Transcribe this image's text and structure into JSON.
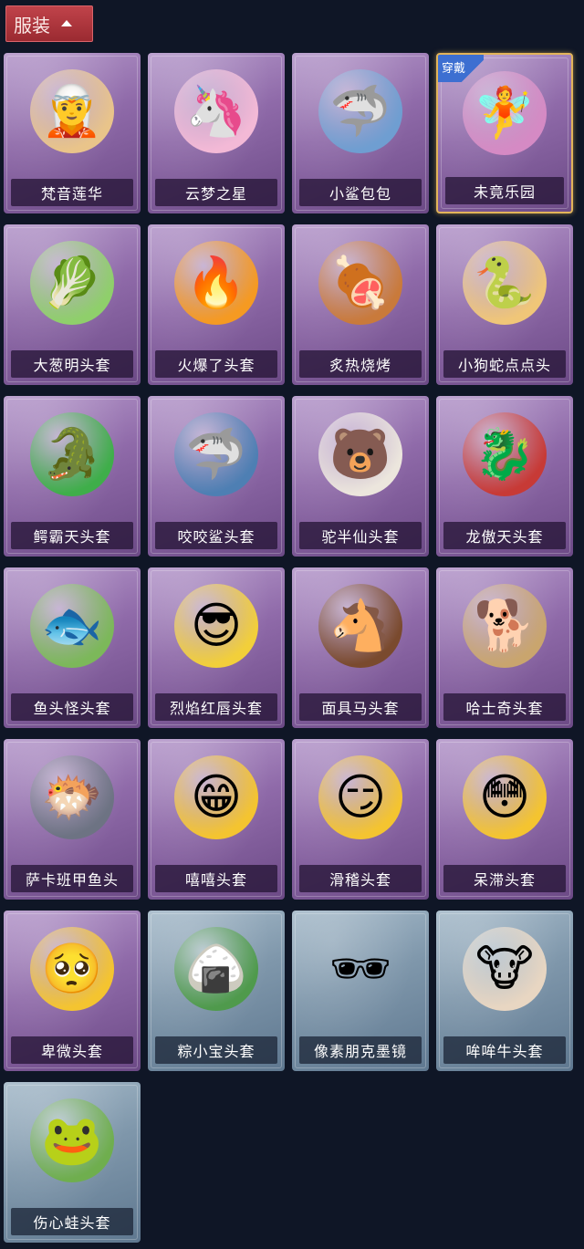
{
  "section": {
    "title": "服装",
    "toggle_icon": "chevron-up-icon"
  },
  "equipped_badge": "穿戴",
  "items": [
    {
      "label": "梵音莲华",
      "theme": "purple",
      "equipped": false,
      "icon": "🧝",
      "art_color": "#e9c48a"
    },
    {
      "label": "云梦之星",
      "theme": "purple",
      "equipped": false,
      "icon": "🦄",
      "art_color": "#f3b9d6"
    },
    {
      "label": "小鲨包包",
      "theme": "purple",
      "equipped": false,
      "icon": "🦈",
      "art_color": "#6f9ed1"
    },
    {
      "label": "未竟乐园",
      "theme": "purple",
      "equipped": true,
      "icon": "🧚",
      "art_color": "#d58ac4"
    },
    {
      "label": "大葱明头套",
      "theme": "purple",
      "equipped": false,
      "icon": "🥬",
      "art_color": "#8fcf6b"
    },
    {
      "label": "火爆了头套",
      "theme": "purple",
      "equipped": false,
      "icon": "🔥",
      "art_color": "#f59a22"
    },
    {
      "label": "炙热烧烤",
      "theme": "purple",
      "equipped": false,
      "icon": "🍖",
      "art_color": "#c97a3b"
    },
    {
      "label": "小狗蛇点点头",
      "theme": "purple",
      "equipped": false,
      "icon": "🐍",
      "art_color": "#f0c678"
    },
    {
      "label": "鳄霸天头套",
      "theme": "purple",
      "equipped": false,
      "icon": "🐊",
      "art_color": "#3fae4a"
    },
    {
      "label": "咬咬鲨头套",
      "theme": "purple",
      "equipped": false,
      "icon": "🦈",
      "art_color": "#4e7fb3"
    },
    {
      "label": "驼半仙头套",
      "theme": "purple",
      "equipped": false,
      "icon": "🐻",
      "art_color": "#ece6dd"
    },
    {
      "label": "龙傲天头套",
      "theme": "purple",
      "equipped": false,
      "icon": "🐉",
      "art_color": "#c73a36"
    },
    {
      "label": "鱼头怪头套",
      "theme": "purple",
      "equipped": false,
      "icon": "🐟",
      "art_color": "#7cb85a"
    },
    {
      "label": "烈焰红唇头套",
      "theme": "purple",
      "equipped": false,
      "icon": "😎",
      "art_color": "#f2cf3a"
    },
    {
      "label": "面具马头套",
      "theme": "purple",
      "equipped": false,
      "icon": "🐴",
      "art_color": "#7a4a2e"
    },
    {
      "label": "哈士奇头套",
      "theme": "purple",
      "equipped": false,
      "icon": "🐕",
      "art_color": "#c9a56e"
    },
    {
      "label": "萨卡班甲鱼头",
      "theme": "purple",
      "equipped": false,
      "icon": "🐡",
      "art_color": "#6d7383"
    },
    {
      "label": "嘻嘻头套",
      "theme": "purple",
      "equipped": false,
      "icon": "😁",
      "art_color": "#f4c430"
    },
    {
      "label": "滑稽头套",
      "theme": "purple",
      "equipped": false,
      "icon": "😏",
      "art_color": "#f4c430"
    },
    {
      "label": "呆滞头套",
      "theme": "purple",
      "equipped": false,
      "icon": "😳",
      "art_color": "#f4c430"
    },
    {
      "label": "卑微头套",
      "theme": "purple",
      "equipped": false,
      "icon": "🥺",
      "art_color": "#f4c430"
    },
    {
      "label": "粽小宝头套",
      "theme": "blue",
      "equipped": false,
      "icon": "🍙",
      "art_color": "#4f9a4c"
    },
    {
      "label": "像素朋克墨镜",
      "theme": "blue",
      "equipped": false,
      "icon": "🕶",
      "art_color": "transparent"
    },
    {
      "label": "哞哞牛头套",
      "theme": "blue",
      "equipped": false,
      "icon": "🐮",
      "art_color": "#e8d6c2"
    },
    {
      "label": "伤心蛙头套",
      "theme": "blue",
      "equipped": false,
      "icon": "🐸",
      "art_color": "#6fae4e"
    }
  ]
}
